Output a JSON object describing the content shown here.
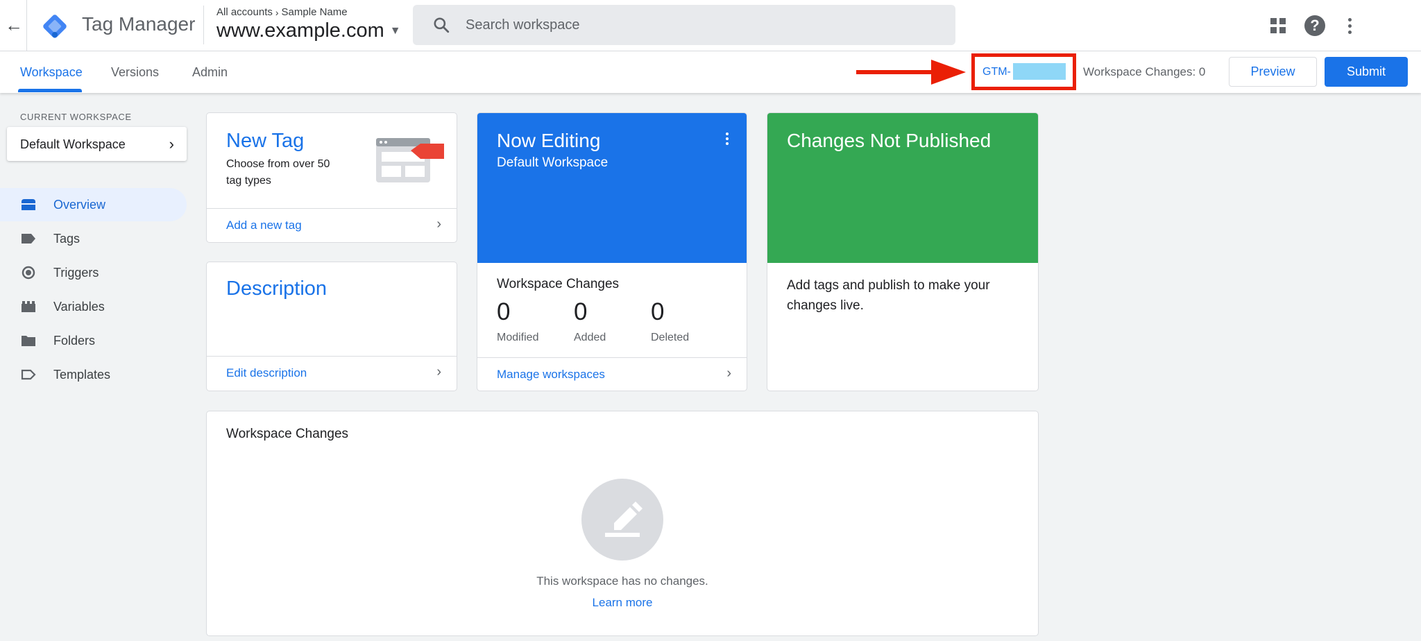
{
  "header": {
    "back_icon": "arrow-back-icon",
    "logo_icon": "tag-manager-logo",
    "app_title": "Tag Manager",
    "breadcrumb": [
      "All accounts",
      "Sample Name"
    ],
    "container_name": "www.example.com",
    "search_placeholder": "Search workspace",
    "icons": [
      "apps-icon",
      "help-icon",
      "more-vert-icon"
    ]
  },
  "tabs": [
    {
      "label": "Workspace",
      "active": true
    },
    {
      "label": "Versions",
      "active": false
    },
    {
      "label": "Admin",
      "active": false
    }
  ],
  "toolbar": {
    "container_id": "GTM-",
    "workspace_changes": "Workspace Changes: 0",
    "preview_label": "Preview",
    "submit_label": "Submit"
  },
  "sidebar": {
    "current_workspace_label": "CURRENT WORKSPACE",
    "current_workspace": "Default Workspace",
    "items": [
      {
        "label": "Overview",
        "icon": "overview-icon",
        "active": true
      },
      {
        "label": "Tags",
        "icon": "tag-icon",
        "active": false
      },
      {
        "label": "Triggers",
        "icon": "trigger-icon",
        "active": false
      },
      {
        "label": "Variables",
        "icon": "variables-icon",
        "active": false
      },
      {
        "label": "Folders",
        "icon": "folder-icon",
        "active": false
      },
      {
        "label": "Templates",
        "icon": "template-icon",
        "active": false
      }
    ]
  },
  "new_tag": {
    "title": "New Tag",
    "description": "Choose from over 50 tag types",
    "link": "Add a new tag"
  },
  "description_card": {
    "title": "Description",
    "link": "Edit description"
  },
  "now_editing": {
    "title": "Now Editing",
    "workspace": "Default Workspace",
    "changes_heading": "Workspace Changes",
    "stats": [
      {
        "value": "0",
        "label": "Modified"
      },
      {
        "value": "0",
        "label": "Added"
      },
      {
        "value": "0",
        "label": "Deleted"
      }
    ],
    "link": "Manage workspaces"
  },
  "not_published": {
    "title": "Changes Not Published",
    "body": "Add tags and publish to make your changes live."
  },
  "workspace_changes": {
    "title": "Workspace Changes",
    "empty_text": "This workspace has no changes.",
    "learn_more": "Learn more",
    "icon": "edit-icon"
  },
  "colors": {
    "primary_blue": "#1a73e8",
    "green": "#34a853",
    "annotation_red": "#ea1f06",
    "redaction": "#8fd7f7"
  }
}
